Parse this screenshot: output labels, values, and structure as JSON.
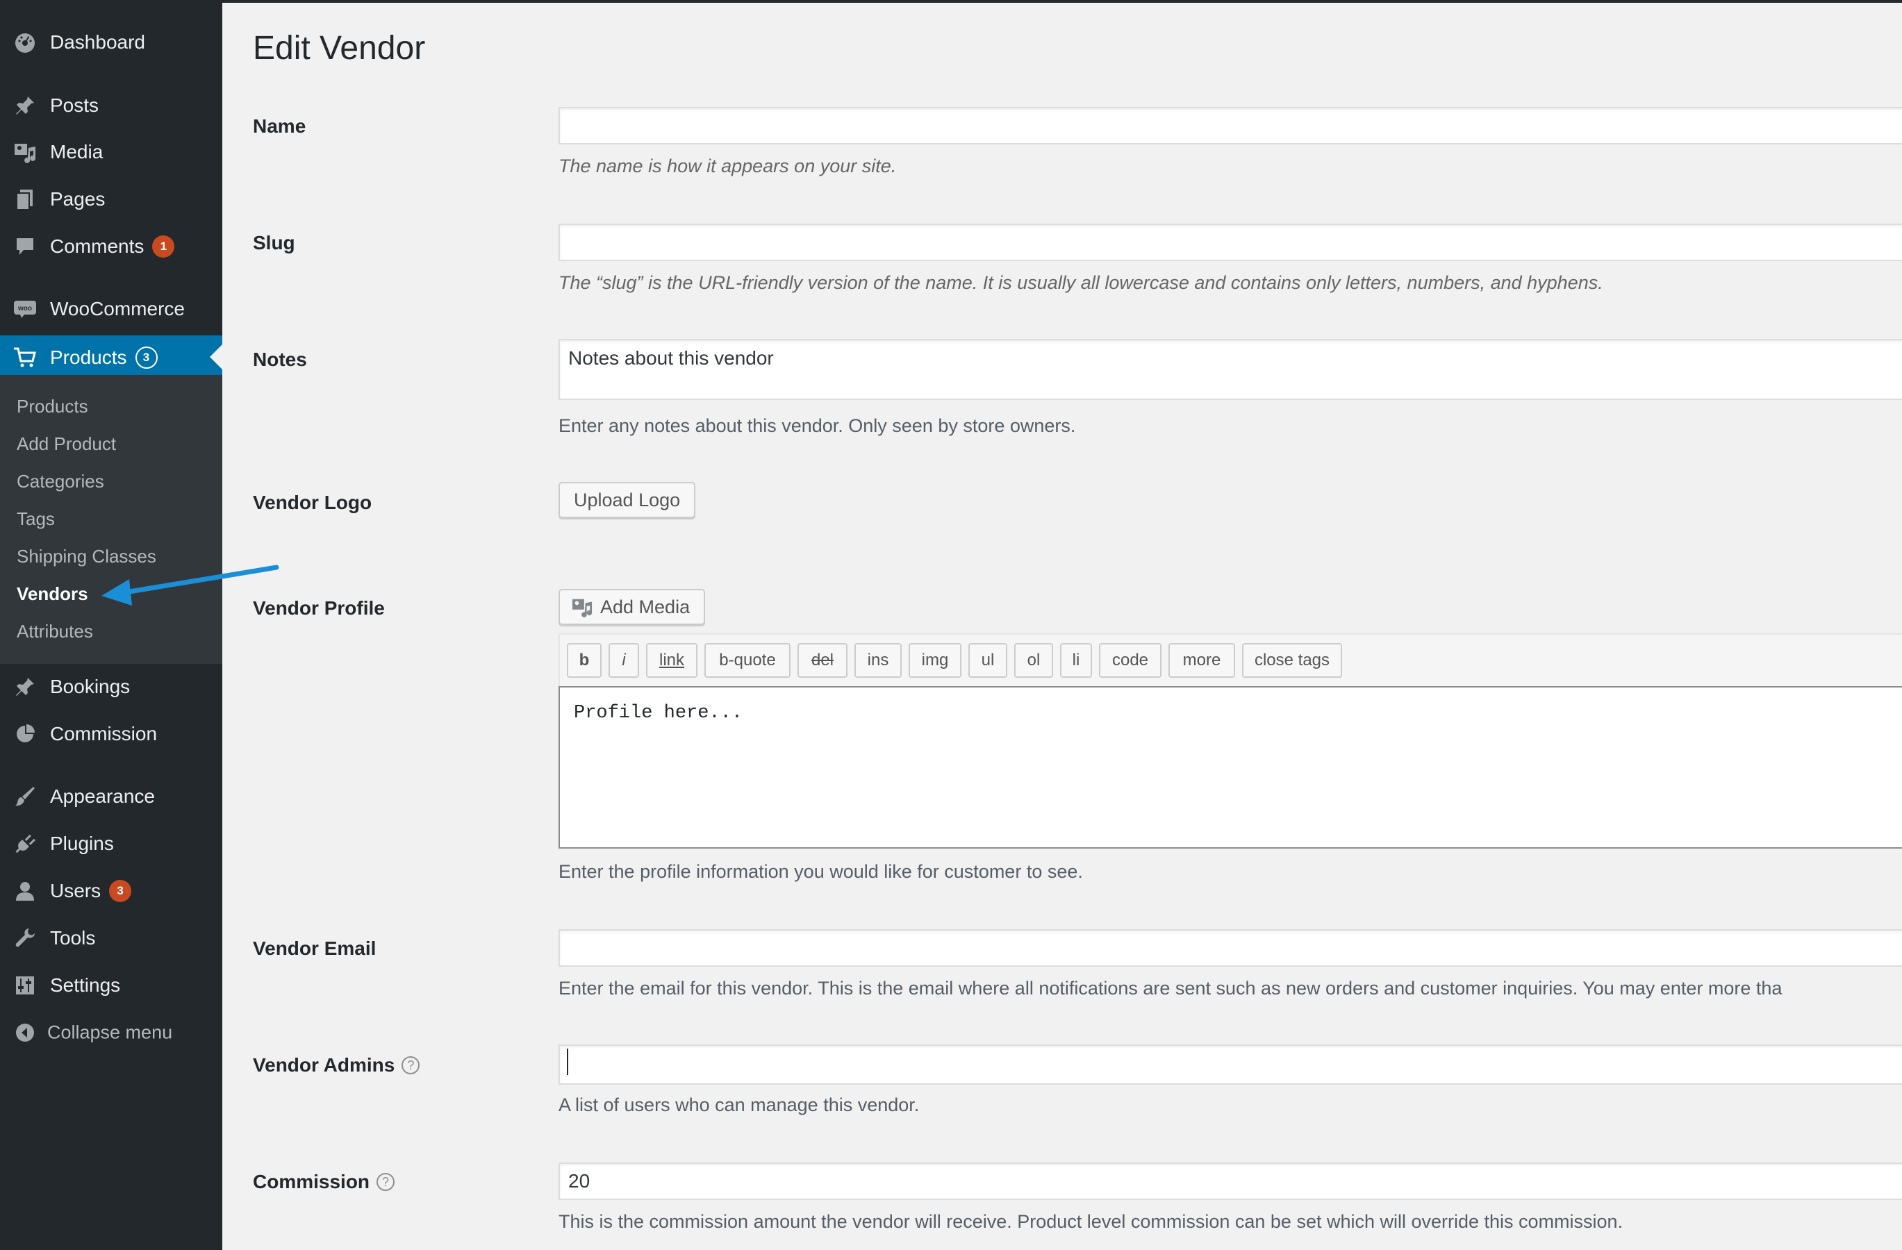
{
  "sidebar": {
    "items": [
      {
        "label": "Dashboard",
        "icon": "dashboard-icon"
      },
      {
        "label": "Posts",
        "icon": "pin-icon"
      },
      {
        "label": "Media",
        "icon": "media-icon"
      },
      {
        "label": "Pages",
        "icon": "pages-icon"
      },
      {
        "label": "Comments",
        "icon": "comment-icon",
        "badge": "1"
      },
      {
        "label": "WooCommerce",
        "icon": "woo-icon"
      },
      {
        "label": "Products",
        "icon": "cart-icon",
        "badge": "3"
      },
      {
        "label": "Bookings",
        "icon": "pin-icon"
      },
      {
        "label": "Commission",
        "icon": "pie-chart-icon"
      },
      {
        "label": "Appearance",
        "icon": "brush-icon"
      },
      {
        "label": "Plugins",
        "icon": "plug-icon"
      },
      {
        "label": "Users",
        "icon": "user-icon",
        "badge": "3"
      },
      {
        "label": "Tools",
        "icon": "wrench-icon"
      },
      {
        "label": "Settings",
        "icon": "sliders-icon"
      },
      {
        "label": "Collapse menu",
        "icon": "collapse-icon"
      }
    ],
    "submenu": [
      "Products",
      "Add Product",
      "Categories",
      "Tags",
      "Shipping Classes",
      "Vendors",
      "Attributes"
    ]
  },
  "page": {
    "title": "Edit Vendor",
    "name": {
      "label": "Name",
      "value": "",
      "description": "The name is how it appears on your site."
    },
    "slug": {
      "label": "Slug",
      "value": "",
      "description": "The “slug” is the URL-friendly version of the name. It is usually all lowercase and contains only letters, numbers, and hyphens."
    },
    "notes": {
      "label": "Notes",
      "value": "Notes about this vendor",
      "description": "Enter any notes about this vendor. Only seen by store owners."
    },
    "logo": {
      "label": "Vendor Logo",
      "button": "Upload Logo"
    },
    "profile": {
      "label": "Vendor Profile",
      "add_media": "Add Media",
      "toolbar": [
        "b",
        "i",
        "link",
        "b-quote",
        "del",
        "ins",
        "img",
        "ul",
        "ol",
        "li",
        "code",
        "more",
        "close tags"
      ],
      "value": "Profile here...",
      "description": "Enter the profile information you would like for customer to see."
    },
    "email": {
      "label": "Vendor Email",
      "value": "",
      "description": "Enter the email for this vendor. This is the email where all notifications are sent such as new orders and customer inquiries. You may enter more tha"
    },
    "admins": {
      "label": "Vendor Admins",
      "help": "?",
      "value": "",
      "description": "A list of users who can manage this vendor."
    },
    "commission": {
      "label": "Commission",
      "help": "?",
      "value": "20",
      "description": "This is the commission amount the vendor will receive. Product level commission can be set which will override this commission."
    }
  },
  "colors": {
    "sidebar_bg": "#23282d",
    "submenu_bg": "#32373c",
    "active": "#0073aa",
    "badge": "#ca4a1f",
    "arrow": "#1a8fd8"
  }
}
